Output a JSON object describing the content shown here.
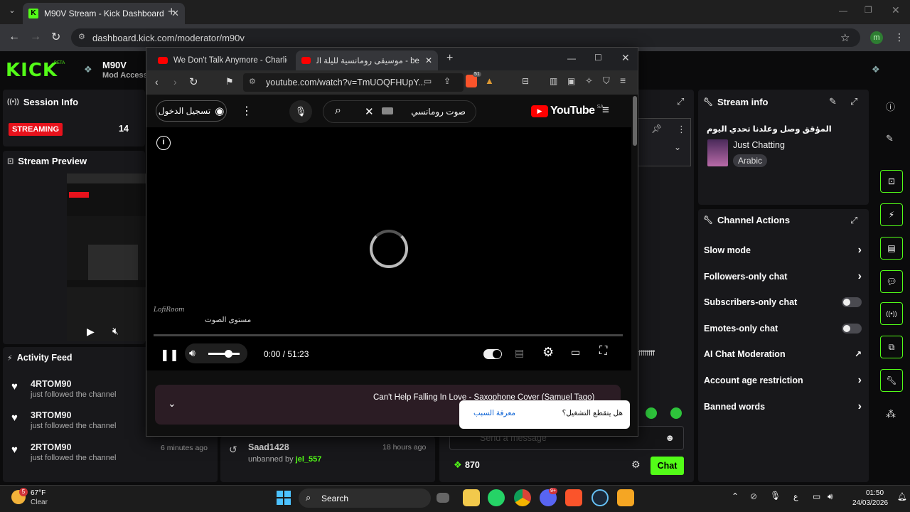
{
  "browser": {
    "tab_title": "M90V Stream - Kick Dashboard",
    "url": "dashboard.kick.com/moderator/m90v",
    "profile_initial": "m"
  },
  "kick": {
    "logo_text": "KICK",
    "beta": "BETA",
    "channel_name": "M90V",
    "channel_sub": "Mod Access",
    "session": {
      "title": "Session Info",
      "status": "STREAMING",
      "viewers": "14"
    },
    "preview_title": "Stream Preview",
    "activity": {
      "title": "Activity Feed",
      "items": [
        {
          "name": "4RTOM90",
          "text": "just followed the channel",
          "time": ""
        },
        {
          "name": "3RTOM90",
          "text": "just followed the channel",
          "time": ""
        },
        {
          "name": "2RTOM90",
          "text": "just followed the channel",
          "time": "6 minutes ago"
        }
      ]
    },
    "mod_log": {
      "name": "Saad1428",
      "action": "unbanned by",
      "by": "jel_557",
      "time": "18 hours ago"
    },
    "chat": {
      "placeholder": "Send a message",
      "points": "870",
      "chat_button": "Chat",
      "fragment": "ffffffff"
    },
    "stream_info": {
      "title": "Stream info",
      "stream_title": "المؤقق وصل وعلدنا تحدي اليوم",
      "category": "Just Chatting",
      "tag": "Arabic"
    },
    "channel_actions": {
      "title": "Channel Actions",
      "items": [
        {
          "label": "Slow mode",
          "control": "chevron"
        },
        {
          "label": "Followers-only chat",
          "control": "chevron"
        },
        {
          "label": "Subscribers-only chat",
          "control": "toggle"
        },
        {
          "label": "Emotes-only chat",
          "control": "toggle"
        },
        {
          "label": "AI Chat Moderation",
          "control": "external"
        },
        {
          "label": "Account age restriction",
          "control": "chevron"
        },
        {
          "label": "Banned words",
          "control": "chevron"
        }
      ]
    }
  },
  "popup": {
    "tab1": "We Don't Talk Anymore - Charlie Puth",
    "tab2": "be - موسيقى رومانسية لليلة الحب",
    "url": "youtube.com/watch?v=TmUOQFHUpY...",
    "yt_logo": "YouTube",
    "yt_region": "SA",
    "search_value": "صوت رومانسي",
    "sign_in": "تسجيل الدخول",
    "volume_tooltip": "مستوى الصوت",
    "time": "0:00 / 51:23",
    "playlist_item": "Can't Help Falling In Love - Saxophone Cover (Samuel Tago)",
    "toast_text": "هل يتقطع التشغيل؟",
    "toast_link": "معرفة السبب",
    "ext_badge": "51"
  },
  "taskbar": {
    "temp": "67°F",
    "weather": "Clear",
    "search": "Search",
    "lang": "ع",
    "time": "01:50",
    "date": "24/03/2026",
    "weather_badge": "5",
    "discord_badge": "9+"
  },
  "colors": {
    "kick_green": "#53fc18",
    "streaming_red": "#e8121c",
    "yt_red": "#ff0000"
  }
}
